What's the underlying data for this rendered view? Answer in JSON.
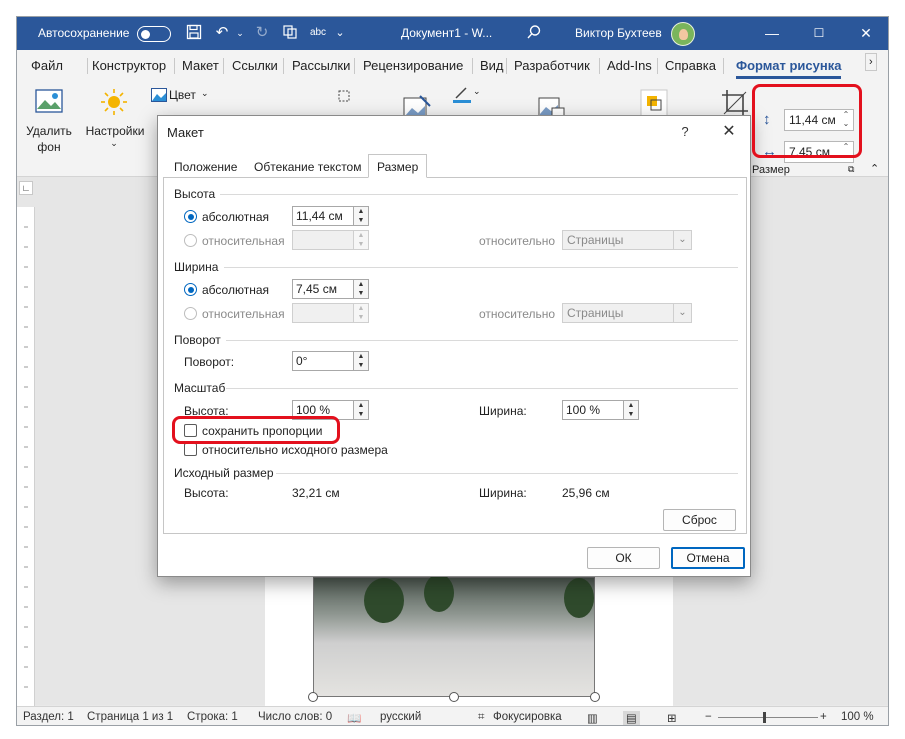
{
  "titlebar": {
    "autosave_label": "Автосохранение",
    "doc_title": "Документ1 - W...",
    "user_name": "Виктор Бухтеев",
    "minimize": "—",
    "maximize": "☐",
    "close": "✕"
  },
  "ribbon_tabs": [
    "Файл",
    "Конструктор",
    "Макет",
    "Ссылки",
    "Рассылки",
    "Рецензирование",
    "Вид",
    "Разработчик",
    "Add-Ins",
    "Справка",
    "Формат рисунка"
  ],
  "ribbon": {
    "remove_bg_line1": "Удалить",
    "remove_bg_line2": "фон",
    "settings_label": "Настройки",
    "color_label": "Цвет",
    "height_value": "11,44 см",
    "width_value": "7,45 см",
    "size_group_label": "Размер"
  },
  "dialog": {
    "title": "Макет",
    "help": "?",
    "close": "✕",
    "tabs": [
      "Положение",
      "Обтекание текстом",
      "Размер"
    ],
    "height_section": "Высота",
    "absolute_label": "абсолютная",
    "relative_label": "относительная",
    "height_abs_value": "11,44 см",
    "relative_to_label": "относительно",
    "relative_to_value": "Страницы",
    "width_section": "Ширина",
    "width_abs_value": "7,45 см",
    "rotation_section": "Поворот",
    "rotation_label": "Поворот:",
    "rotation_value": "0°",
    "scale_section": "Масштаб",
    "scale_height_label": "Высота:",
    "scale_height_value": "100 %",
    "scale_width_label": "Ширина:",
    "scale_width_value": "100 %",
    "lock_aspect_label": "сохранить пропорции",
    "relative_original_label": "относительно исходного размера",
    "original_section": "Исходный размер",
    "orig_height_label": "Высота:",
    "orig_height_value": "32,21 см",
    "orig_width_label": "Ширина:",
    "orig_width_value": "25,96 см",
    "reset_button": "Сброс",
    "ok_button": "ОК",
    "cancel_button": "Отмена"
  },
  "statusbar": {
    "section": "Раздел: 1",
    "page": "Страница 1 из 1",
    "line": "Строка: 1",
    "words": "Число слов: 0",
    "language": "русский",
    "focus": "Фокусировка",
    "zoom_minus": "−",
    "zoom_plus": "+",
    "zoom": "100 %"
  },
  "colors": {
    "titlebar": "#2b579a",
    "accent": "#0067c0",
    "highlight": "#e3101d"
  }
}
